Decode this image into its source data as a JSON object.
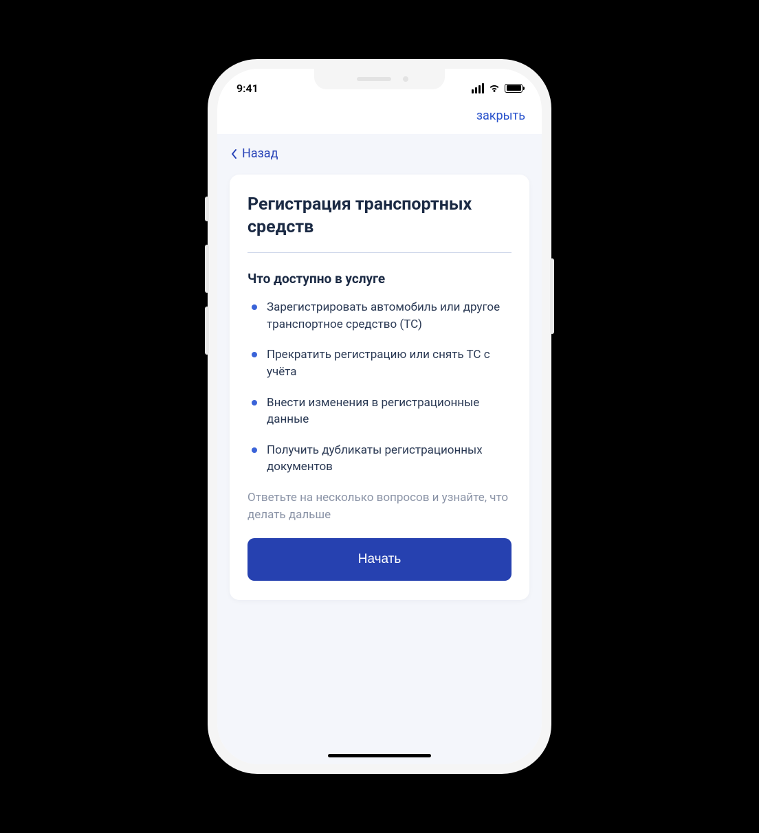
{
  "status": {
    "time": "9:41"
  },
  "top": {
    "close": "закрыть"
  },
  "nav": {
    "back": "Назад"
  },
  "card": {
    "title": "Регистрация транспортных средств",
    "subtitle": "Что доступно в услуге",
    "items": [
      "Зарегистрировать автомобиль или другое транспортное средство (ТС)",
      "Прекратить регистрацию или снять ТС с учёта",
      "Внести изменения в регистрационные данные",
      "Получить дубликаты регистрационных документов"
    ],
    "hint": "Ответьте на несколько вопросов и узнайте, что делать дальше",
    "cta": "Начать"
  }
}
